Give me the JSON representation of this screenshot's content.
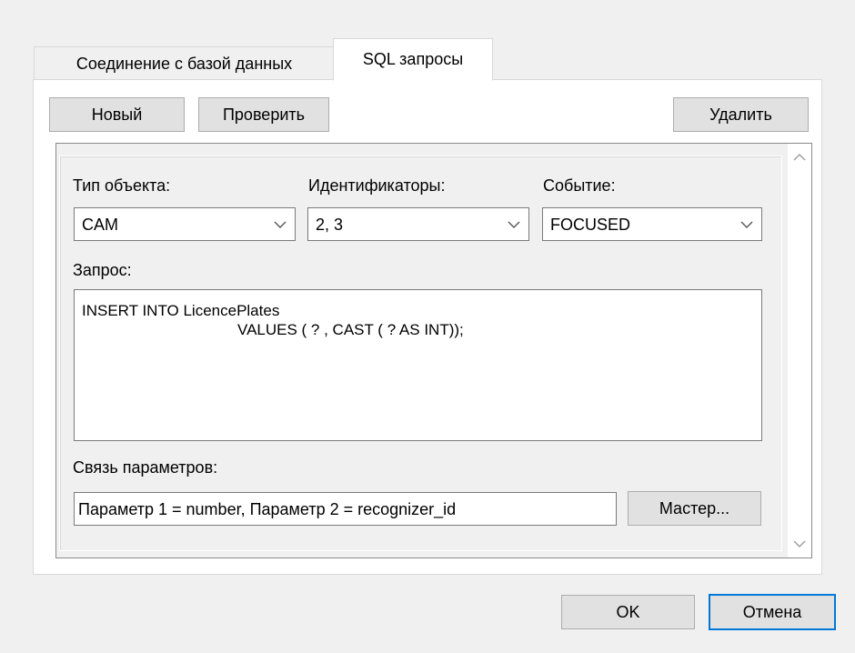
{
  "tabs": [
    {
      "label": "Соединение с базой данных",
      "active": false
    },
    {
      "label": "SQL запросы",
      "active": true
    }
  ],
  "toolbar": {
    "new_label": "Новый",
    "check_label": "Проверить",
    "delete_label": "Удалить"
  },
  "form": {
    "object_type": {
      "label": "Тип объекта:",
      "value": "CAM"
    },
    "identifiers": {
      "label": "Идентификаторы:",
      "value": "2, 3"
    },
    "event": {
      "label": "Событие:",
      "value": "FOCUSED"
    },
    "query": {
      "label": "Запрос:",
      "lines": [
        "INSERT INTO LicencePlates",
        "VALUES ( ? , CAST ( ? AS INT));"
      ]
    },
    "params": {
      "label": "Связь параметров:",
      "value": "Параметр 1 = number, Параметр 2 = recognizer_id",
      "wizard_label": "Мастер..."
    }
  },
  "footer": {
    "ok_label": "OK",
    "cancel_label": "Отмена"
  },
  "colors": {
    "dialog_bg": "#f0f0f0",
    "tab_page_bg": "#ffffff",
    "focus_border": "#0078d7",
    "button_bg": "#e1e1e1"
  },
  "icons": {
    "combo_arrow": "chevron-down-icon",
    "scroll_up": "chevron-up-icon",
    "scroll_down": "chevron-down-icon"
  }
}
